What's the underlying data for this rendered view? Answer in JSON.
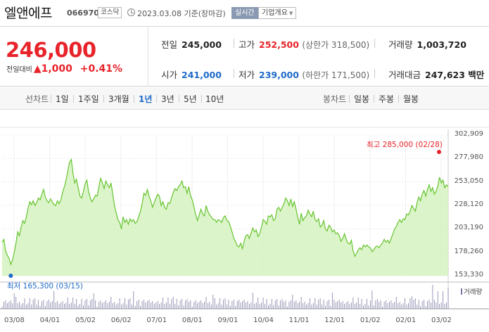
{
  "header": {
    "stock_name": "엘앤에프",
    "stock_code": "066970",
    "market_badge": "코스닥",
    "as_of": "2023.03.08 기준(장마감)",
    "realtime_button": "실시간",
    "company_info_button": "기업개요",
    "company_info_icon": "chevron-down-icon"
  },
  "price": {
    "current": "246,000",
    "change_label": "전일대비",
    "change_arrow": "▲",
    "change_amount": "1,000",
    "change_percent": "+0.41%"
  },
  "stats": {
    "prev_close_label": "전일",
    "prev_close": "245,000",
    "high_label": "고가",
    "high": "252,500",
    "upper_limit": "(상한가 318,500)",
    "volume_label": "거래량",
    "volume": "1,003,720",
    "open_label": "시가",
    "open": "241,000",
    "low_label": "저가",
    "low": "239,000",
    "lower_limit": "(하한가 171,500)",
    "trade_value_label": "거래대금",
    "trade_value": "247,623 백만"
  },
  "tabs": {
    "line_chart_label": "선차트",
    "periods": [
      "1일",
      "1주일",
      "3개월",
      "1년",
      "3년",
      "5년",
      "10년"
    ],
    "selected_period": "1년",
    "candle_chart_label": "봉차트",
    "candle_periods": [
      "일봉",
      "주봉",
      "월봉"
    ]
  },
  "colors": {
    "up": "#e8232a",
    "down": "#1e6ac8",
    "area_fill": "#d6f2c0",
    "line": "#66c430"
  },
  "chart_data": {
    "type": "area",
    "title": "",
    "xlabel": "",
    "ylabel": "",
    "x_tick_labels": [
      "03/08",
      "04/01",
      "05/02",
      "06/02",
      "07/01",
      "08/01",
      "09/01",
      "10/04",
      "11/01",
      "12/01",
      "01/02",
      "02/01",
      "03/02"
    ],
    "y_tick_labels": [
      "302,909",
      "277,980",
      "253,050",
      "228,120",
      "203,190",
      "178,260",
      "153,330"
    ],
    "ylim": [
      153330,
      302909
    ],
    "grid": true,
    "high_annotation": "최고 285,000 (02/28)",
    "low_annotation": "최저 165,300 (03/15)",
    "series": [
      {
        "values": [
          189000,
          192000,
          180000,
          175000,
          172000,
          165300,
          170000,
          178000,
          188000,
          200000,
          196000,
          205000,
          212000,
          209000,
          216000,
          225000,
          232000,
          229000,
          233000,
          228000,
          231000,
          236000,
          234000,
          240000,
          245000,
          237000,
          233000,
          231000,
          235000,
          232000,
          229000,
          228000,
          233000,
          230000,
          234000,
          242000,
          248000,
          255000,
          265000,
          274000,
          277000,
          262000,
          252000,
          256000,
          247000,
          238000,
          236000,
          243000,
          251000,
          255000,
          243000,
          236000,
          232000,
          235000,
          239000,
          238000,
          248000,
          257000,
          252000,
          246000,
          254000,
          250000,
          247000,
          252000,
          240000,
          228000,
          220000,
          213000,
          210000,
          203000,
          216000,
          210000,
          213000,
          208000,
          214000,
          211000,
          213000,
          209000,
          211000,
          216000,
          222000,
          230000,
          241000,
          239000,
          245000,
          238000,
          233000,
          226000,
          231000,
          236000,
          240000,
          238000,
          228000,
          232000,
          226000,
          224000,
          231000,
          230000,
          236000,
          242000,
          246000,
          244000,
          248000,
          250000,
          254000,
          247000,
          248000,
          241000,
          248000,
          238000,
          234000,
          226000,
          218000,
          212000,
          218000,
          224000,
          219000,
          217000,
          228000,
          222000,
          218000,
          216000,
          213000,
          213000,
          210000,
          213000,
          212000,
          210000,
          215000,
          217000,
          212000,
          211000,
          206000,
          200000,
          193000,
          190000,
          185000,
          184000,
          188000,
          182000,
          190000,
          196000,
          197000,
          193000,
          199000,
          204000,
          200000,
          202000,
          195000,
          198000,
          205000,
          213000,
          211000,
          208000,
          217000,
          216000,
          218000,
          212000,
          214000,
          224000,
          226000,
          222000,
          226000,
          230000,
          236000,
          233000,
          228000,
          235000,
          227000,
          232000,
          224000,
          215000,
          208000,
          220000,
          212000,
          215000,
          217000,
          223000,
          219000,
          216000,
          222000,
          213000,
          211000,
          214000,
          205000,
          207000,
          212000,
          203000,
          201000,
          207000,
          205000,
          200000,
          202000,
          198000,
          199000,
          196000,
          190000,
          193000,
          198000,
          192000,
          188000,
          187000,
          191000,
          180000,
          174000,
          177000,
          181000,
          183000,
          181000,
          186000,
          184000,
          186000,
          184000,
          183000,
          179000,
          181000,
          184000,
          185000,
          183000,
          186000,
          188000,
          192000,
          189000,
          191000,
          188000,
          193000,
          198000,
          203000,
          206000,
          210000,
          213000,
          210000,
          214000,
          213000,
          219000,
          218000,
          222000,
          228000,
          225000,
          222000,
          231000,
          237000,
          233000,
          240000,
          244000,
          238000,
          245000,
          250000,
          243000,
          247000,
          240000,
          243000,
          249000,
          258000,
          252000,
          255000,
          247000,
          250000,
          248000
        ]
      }
    ],
    "volume_label": "거래량"
  }
}
